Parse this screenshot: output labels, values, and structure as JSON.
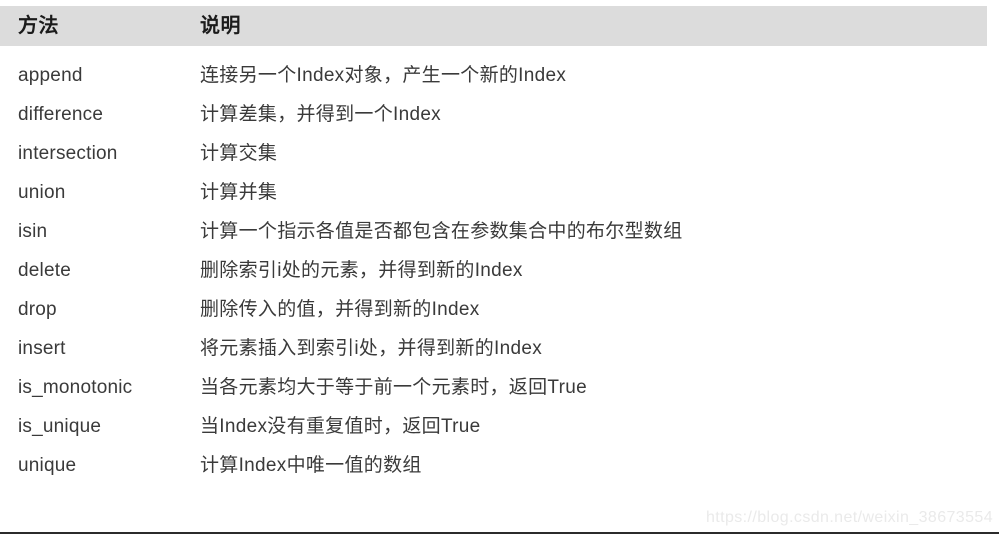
{
  "table": {
    "headers": {
      "method": "方法",
      "description": "说明"
    },
    "rows": [
      {
        "method": "append",
        "description": "连接另一个Index对象，产生一个新的Index"
      },
      {
        "method": "difference",
        "description": "计算差集，并得到一个Index"
      },
      {
        "method": "intersection",
        "description": "计算交集"
      },
      {
        "method": "union",
        "description": "计算并集"
      },
      {
        "method": "isin",
        "description": "计算一个指示各值是否都包含在参数集合中的布尔型数组"
      },
      {
        "method": "delete",
        "description": "删除索引i处的元素，并得到新的Index"
      },
      {
        "method": "drop",
        "description": "删除传入的值，并得到新的Index"
      },
      {
        "method": "insert",
        "description": "将元素插入到索引i处，并得到新的Index"
      },
      {
        "method": "is_monotonic",
        "description": "当各元素均大于等于前一个元素时，返回True"
      },
      {
        "method": "is_unique",
        "description": "当Index没有重复值时，返回True"
      },
      {
        "method": "unique",
        "description": "计算Index中唯一值的数组"
      }
    ]
  },
  "watermark": {
    "text": "https://blog.csdn.net/weixin_38673554"
  },
  "colors": {
    "header_background": "#dcdcdc",
    "header_text": "#1b1b1b",
    "body_text": "#3a3a3a",
    "page_background": "#ffffff",
    "bottom_rule": "#2b2b2b",
    "watermark_text": "#eaeaea"
  }
}
